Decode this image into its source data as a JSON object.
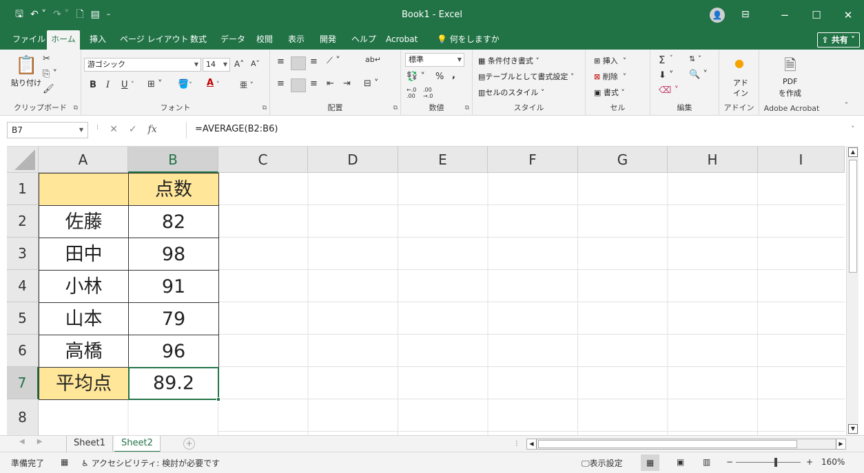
{
  "titlebar": {
    "title": "Book1  -  Excel",
    "save_icon": "save-icon",
    "undo_icon": "undo-icon",
    "redo_icon": "redo-icon",
    "avatar_glyph": "ⓐ",
    "minimize": "−",
    "maximize": "☐",
    "close": "✕"
  },
  "tabs": [
    "ファイル",
    "ホーム",
    "挿入",
    "ページ レイアウト",
    "数式",
    "データ",
    "校閲",
    "表示",
    "開発",
    "ヘルプ",
    "Acrobat"
  ],
  "active_tab": "ホーム",
  "tell_me": "何をしますか",
  "share": "共有",
  "ribbon": {
    "clipboard": {
      "paste": "貼り付け",
      "label": "クリップボード"
    },
    "font": {
      "name": "游ゴシック",
      "size": "14",
      "bold": "B",
      "italic": "I",
      "underline": "U",
      "font_color_letter": "A",
      "label": "フォント",
      "grow": "A",
      "shrink": "A",
      "phonetic": "亜"
    },
    "alignment": {
      "label": "配置",
      "wrap": "ab",
      "wrap_sub": "c"
    },
    "number": {
      "format": "標準",
      "percent": "%",
      "comma": ",",
      "inc": "←.0 .00",
      "dec": ".00 →.0",
      "label": "数値"
    },
    "styles": {
      "conditional": "条件付き書式",
      "table": "テーブルとして書式設定",
      "cell_styles": "セルのスタイル",
      "label": "スタイル"
    },
    "cells": {
      "insert": "挿入",
      "delete": "削除",
      "format": "書式",
      "label": "セル"
    },
    "editing": {
      "sum": "Σ",
      "label": "編集"
    },
    "addins": {
      "line1": "アド",
      "line2": "イン",
      "label": "アドイン"
    },
    "acrobat": {
      "line1": "PDF",
      "line2": "を作成",
      "label": "Adobe Acrobat"
    }
  },
  "formula_bar": {
    "name_box": "B7",
    "fx": "fx",
    "formula": "=AVERAGE(B2:B6)"
  },
  "columns": [
    "A",
    "B",
    "C",
    "D",
    "E",
    "F",
    "G",
    "H",
    "I"
  ],
  "selected_column": "B",
  "rows": [
    "1",
    "2",
    "3",
    "4",
    "5",
    "6",
    "7",
    "8"
  ],
  "selected_row": "7",
  "cells": {
    "A1": "",
    "B1": "点数",
    "A2": "佐藤",
    "B2": "82",
    "A3": "田中",
    "B3": "98",
    "A4": "小林",
    "B4": "91",
    "A5": "山本",
    "B5": "79",
    "A6": "高橋",
    "B6": "96",
    "A7": "平均点",
    "B7": "89.2"
  },
  "highlight_color": "#ffe699",
  "accent_color": "#217346",
  "sheets": [
    "Sheet1",
    "Sheet2"
  ],
  "active_sheet": "Sheet2",
  "status": {
    "ready": "準備完了",
    "accessibility": "アクセシビリティ: 検討が必要です",
    "display_settings": "表示設定",
    "zoom": "160%",
    "zoom_minus": "−",
    "zoom_plus": "+"
  }
}
